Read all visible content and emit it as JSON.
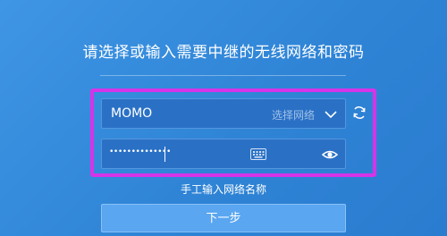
{
  "header": {
    "title": "请选择或输入需要中继的无线网络和密码"
  },
  "network": {
    "value": "MOMO",
    "select_hint": "选择网络",
    "chevron_icon": "chevron-down-icon",
    "refresh_icon": "refresh-icon"
  },
  "password": {
    "masked_value": "••••••••••••••",
    "keyboard_icon": "keyboard-icon",
    "visibility_icon": "eye-icon"
  },
  "links": {
    "manual_input": "手工输入网络名称"
  },
  "actions": {
    "next_label": "下一步"
  },
  "colors": {
    "background": "#3590de",
    "field": "#2a71c6",
    "highlight": "#d534e8",
    "button": "#5aa6f0"
  }
}
